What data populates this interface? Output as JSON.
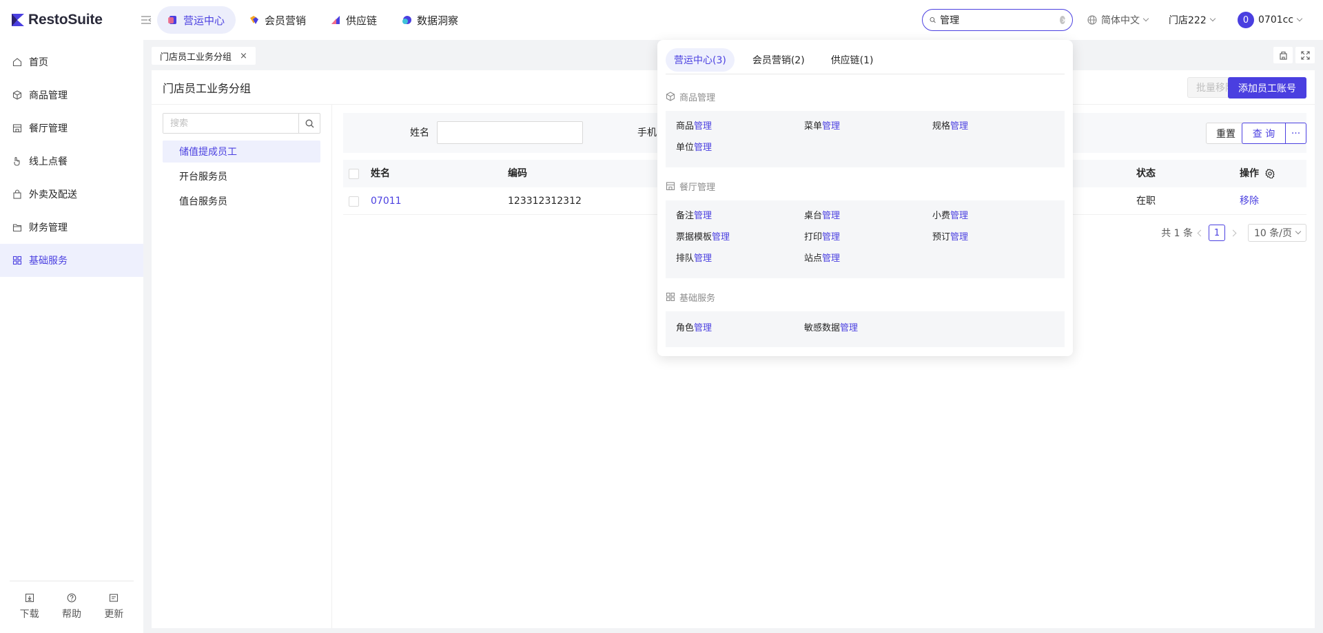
{
  "app": {
    "logo_text": "RestoSuite"
  },
  "topnav": [
    {
      "label": "营运中心",
      "active": true
    },
    {
      "label": "会员营销",
      "active": false
    },
    {
      "label": "供应链",
      "active": false
    },
    {
      "label": "数据洞察",
      "active": false
    }
  ],
  "search": {
    "value": "管理"
  },
  "language": "简体中文",
  "store": "门店222",
  "user": {
    "avatar_text": "0",
    "name": "0701cc"
  },
  "sidebar": {
    "items": [
      {
        "label": "首页",
        "icon": "home-icon"
      },
      {
        "label": "商品管理",
        "icon": "cube-icon"
      },
      {
        "label": "餐厅管理",
        "icon": "store-icon"
      },
      {
        "label": "线上点餐",
        "icon": "hand-icon"
      },
      {
        "label": "外卖及配送",
        "icon": "bag-icon"
      },
      {
        "label": "财务管理",
        "icon": "folder-icon"
      },
      {
        "label": "基础服务",
        "icon": "grid-icon",
        "active": true
      }
    ],
    "bottom": [
      {
        "label": "下载",
        "icon": "download-icon"
      },
      {
        "label": "帮助",
        "icon": "help-icon"
      },
      {
        "label": "更新",
        "icon": "update-icon"
      }
    ]
  },
  "tabs": {
    "open_tab": "门店员工业务分组",
    "close": "×"
  },
  "page": {
    "title": "门店员工业务分组",
    "batch_remove": "批量移除",
    "add_account": "添加员工账号"
  },
  "groups": {
    "search_placeholder": "搜索",
    "items": [
      {
        "label": "储值提成员工",
        "active": true
      },
      {
        "label": "开台服务员"
      },
      {
        "label": "值台服务员"
      }
    ]
  },
  "filter": {
    "name_label": "姓名",
    "phone_label": "手机",
    "reset": "重置",
    "query": "查 询",
    "more": "···"
  },
  "table": {
    "headers": {
      "name": "姓名",
      "code": "编码",
      "status": "状态",
      "action": "操作"
    },
    "rows": [
      {
        "name": "07011",
        "code": "123312312312",
        "status": "在职",
        "action": "移除"
      }
    ]
  },
  "pager": {
    "total": "共 1 条",
    "page": "1",
    "size": "10 条/页"
  },
  "dropdown": {
    "tabs": [
      {
        "label": "营运中心(3)",
        "active": true
      },
      {
        "label": "会员营销(2)"
      },
      {
        "label": "供应链(1)"
      }
    ],
    "sections": [
      {
        "title": "商品管理",
        "icon": "cube-icon",
        "items": [
          {
            "prefix": "商品",
            "hl": "管理"
          },
          {
            "prefix": "菜单",
            "hl": "管理"
          },
          {
            "prefix": "规格",
            "hl": "管理"
          },
          {
            "prefix": "单位",
            "hl": "管理"
          }
        ]
      },
      {
        "title": "餐厅管理",
        "icon": "store-icon",
        "items": [
          {
            "prefix": "备注",
            "hl": "管理"
          },
          {
            "prefix": "桌台",
            "hl": "管理"
          },
          {
            "prefix": "小费",
            "hl": "管理"
          },
          {
            "prefix": "票据模板",
            "hl": "管理"
          },
          {
            "prefix": "打印",
            "hl": "管理"
          },
          {
            "prefix": "预订",
            "hl": "管理"
          },
          {
            "prefix": "排队",
            "hl": "管理"
          },
          {
            "prefix": "站点",
            "hl": "管理"
          }
        ]
      },
      {
        "title": "基础服务",
        "icon": "grid-icon",
        "items": [
          {
            "prefix": "角色",
            "hl": "管理"
          },
          {
            "prefix": "敏感数据",
            "hl": "管理"
          }
        ]
      }
    ]
  },
  "colors": {
    "accent": "#4a3fe0",
    "background": "#f2f3f5"
  }
}
